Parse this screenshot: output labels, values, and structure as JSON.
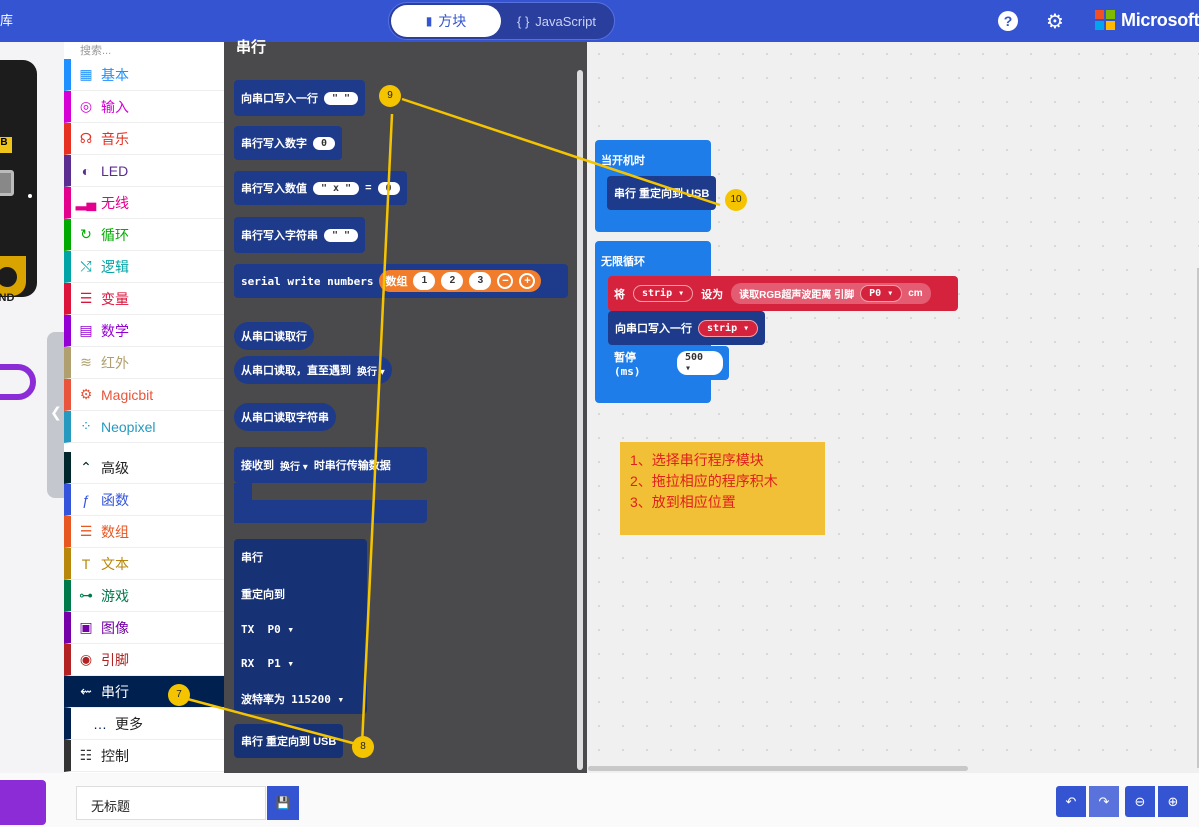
{
  "topbar": {
    "cut_label": "库",
    "mode_blocks": "方块",
    "mode_js": "JavaScript",
    "brand": "Microsoft",
    "accent": "#3454d1"
  },
  "palette": {
    "search_placeholder": "搜索...",
    "categories": [
      {
        "label": "基本",
        "icon": "grid-icon",
        "color": "#1e90ff"
      },
      {
        "label": "输入",
        "icon": "target-icon",
        "color": "#d400d4"
      },
      {
        "label": "音乐",
        "icon": "headphones-icon",
        "color": "#e63022"
      },
      {
        "label": "LED",
        "icon": "toggle-icon",
        "color": "#5c2d91"
      },
      {
        "label": "无线",
        "icon": "signal-icon",
        "color": "#e3008c"
      },
      {
        "label": "循环",
        "icon": "refresh-icon",
        "color": "#00aa00"
      },
      {
        "label": "逻辑",
        "icon": "shuffle-icon",
        "color": "#00a4a6"
      },
      {
        "label": "变量",
        "icon": "list-icon",
        "color": "#dc143c"
      },
      {
        "label": "数学",
        "icon": "calculator-icon",
        "color": "#9400d3"
      },
      {
        "label": "红外",
        "icon": "wifi-icon",
        "color": "#b0a070"
      },
      {
        "label": "Magicbit",
        "icon": "gear-icon",
        "color": "#e8553c"
      },
      {
        "label": "Neopixel",
        "icon": "dots-icon",
        "color": "#2699bf"
      },
      {
        "label": "高级",
        "icon": "chevron-up-icon",
        "color": "#00272b"
      },
      {
        "label": "函数",
        "icon": "function-icon",
        "color": "#3455db"
      },
      {
        "label": "数组",
        "icon": "list-icon",
        "color": "#e65722"
      },
      {
        "label": "文本",
        "icon": "text-icon",
        "color": "#b8860b"
      },
      {
        "label": "游戏",
        "icon": "gamepad-icon",
        "color": "#007a4b"
      },
      {
        "label": "图像",
        "icon": "image-icon",
        "color": "#7600a8"
      },
      {
        "label": "引脚",
        "icon": "pin-icon",
        "color": "#b22222"
      },
      {
        "label": "串行",
        "icon": "usb-icon",
        "color": "#002050"
      },
      {
        "label": "更多",
        "icon": "more-icon",
        "color": "#002050"
      },
      {
        "label": "控制",
        "icon": "control-icon",
        "color": "#333333"
      }
    ]
  },
  "board": {
    "button_label": "B",
    "pin_label": "GND"
  },
  "flyout": {
    "title": "串行",
    "b1": {
      "label": "向串口写入一行",
      "value": "\" \""
    },
    "b2": {
      "label": "串行写入数字",
      "value": "0"
    },
    "b3": {
      "label": "串行写入数值",
      "key": "\" x \"",
      "eq": "=",
      "value": "0"
    },
    "b4": {
      "label": "串行写入字符串",
      "value": "\" \""
    },
    "b5": {
      "label": "serial write numbers",
      "array": "数组",
      "nums": [
        "1",
        "2",
        "3"
      ]
    },
    "b6": {
      "label": "从串口读取行"
    },
    "b7": {
      "label": "从串口读取，直至遇到",
      "value": "换行 ▾"
    },
    "b8": {
      "label": "从串口读取字符串"
    },
    "b9": {
      "label1": "接收到",
      "value": "换行 ▾",
      "label2": "时串行传输数据"
    },
    "b10": {
      "title": "串行",
      "redirect": "重定向到",
      "tx": "TX",
      "tx_val": "P0 ▾",
      "rx": "RX",
      "rx_val": "P1 ▾",
      "baud": "波特率为",
      "baud_val": "115200 ▾"
    },
    "b11": {
      "label": "串行 重定向到 USB"
    }
  },
  "workspace": {
    "on_start": {
      "label": "当开机时",
      "child": "串行 重定向到 USB"
    },
    "forever": {
      "label": "无限循环",
      "set": {
        "label": "将",
        "var": "strip ▾",
        "to": "设为",
        "func": "读取RGB超声波距离 引脚",
        "pin": "P0 ▾",
        "unit": "cm"
      },
      "write": {
        "label": "向串口写入一行",
        "var": "strip ▾"
      },
      "pause": {
        "label": "暂停 (ms)",
        "value": "500 ▾"
      }
    }
  },
  "note": {
    "lines": [
      "1、选择串行程序模块",
      "2、拖拉相应的程序积木",
      "3、放到相应位置"
    ]
  },
  "badges": {
    "b7": "7",
    "b8": "8",
    "b9": "9",
    "b10": "10"
  },
  "bottom": {
    "project_name": "无标题"
  }
}
